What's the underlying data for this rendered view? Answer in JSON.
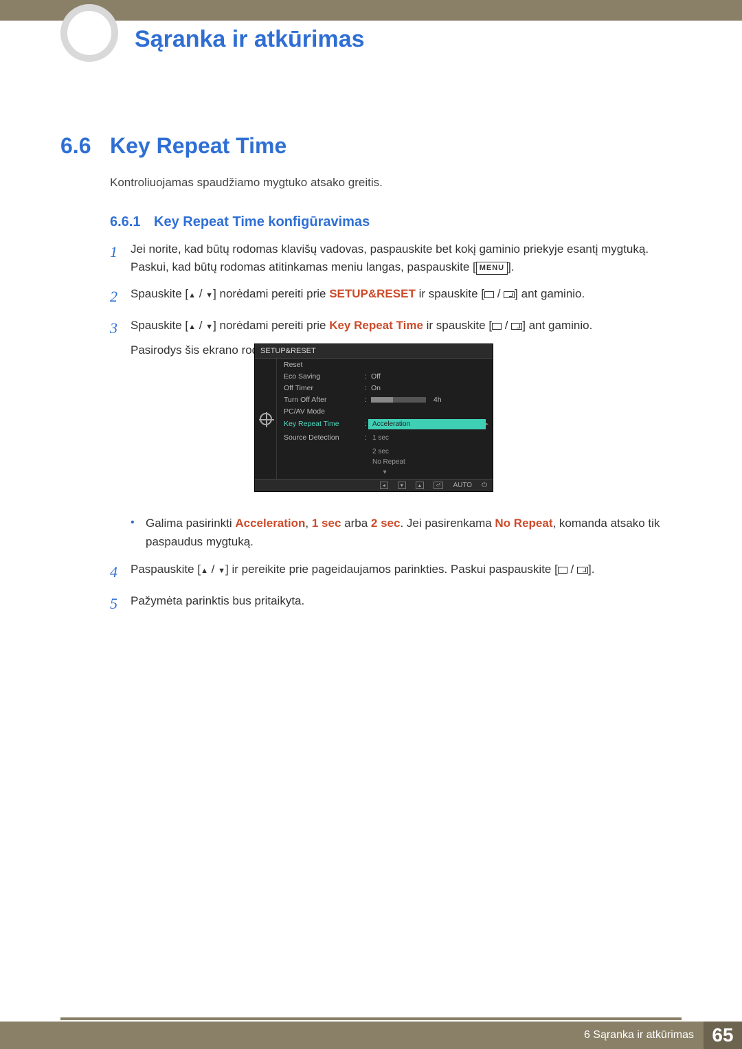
{
  "header": {
    "chapter_title": "Sąranka ir atkūrimas"
  },
  "section": {
    "number": "6.6",
    "title": "Key Repeat Time",
    "intro": "Kontroliuojamas spaudžiamo mygtuko atsako greitis."
  },
  "subsection": {
    "number": "6.6.1",
    "title": "Key Repeat Time konfigūravimas"
  },
  "steps": {
    "s1a": "Jei norite, kad būtų rodomas klavišų vadovas, paspauskite bet kokį gaminio priekyje esantį mygtuką.",
    "s1b_pre": "Paskui, kad būtų rodomas atitinkamas meniu langas, paspauskite [",
    "s1b_post": "].",
    "menu_label": "MENU",
    "s2_pre": "Spauskite [",
    "s2_mid": "] norėdami pereiti prie ",
    "s2_target": "SETUP&RESET",
    "s2_post": " ir spauskite [",
    "s2_end": "] ant gaminio.",
    "s3_pre": "Spauskite [",
    "s3_mid": "] norėdami pereiti prie ",
    "s3_target": "Key Repeat Time",
    "s3_post": " ir spauskite [",
    "s3_end": "] ant gaminio.",
    "s3_after": "Pasirodys šis ekrano rodinys:",
    "bullet_pre": "Galima pasirinkti ",
    "opt_acc": "Acceleration",
    "sep1": ", ",
    "opt_1": "1 sec",
    "sep2": " arba ",
    "opt_2": "2 sec",
    "bullet_mid": ". Jei pasirenkama ",
    "opt_nr": "No Repeat",
    "bullet_post": ", komanda atsako tik paspaudus mygtuką.",
    "s4_pre": "Paspauskite [",
    "s4_mid": "] ir pereikite prie pageidaujamos parinkties. Paskui paspauskite [",
    "s4_end": "].",
    "s5": "Pažymėta parinktis bus pritaikyta."
  },
  "osd": {
    "title": "SETUP&RESET",
    "rows": {
      "reset": "Reset",
      "eco": "Eco Saving",
      "eco_v": "Off",
      "offt": "Off Timer",
      "offt_v": "On",
      "toa": "Turn Off After",
      "toa_v": "4h",
      "pcav": "PC/AV Mode",
      "krt": "Key Repeat Time",
      "sd": "Source Detection"
    },
    "opts": {
      "acc": "Acceleration",
      "o1": "1 sec",
      "o2": "2 sec",
      "nr": "No Repeat"
    },
    "toolbar": {
      "auto": "AUTO"
    }
  },
  "footer": {
    "text": "6 Sąranka ir atkūrimas",
    "page": "65"
  }
}
